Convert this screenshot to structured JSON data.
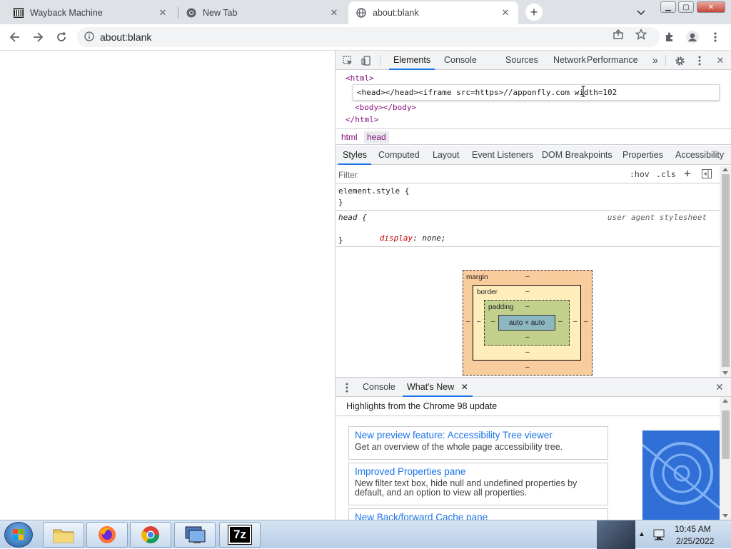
{
  "browser": {
    "tabs": [
      {
        "title": "Wayback Machine",
        "active": false
      },
      {
        "title": "New Tab",
        "active": false
      },
      {
        "title": "about:blank",
        "active": true
      }
    ],
    "url": "about:blank"
  },
  "devtools": {
    "tabs": [
      "Elements",
      "Console",
      "Sources",
      "Network",
      "Performance"
    ],
    "more": "»",
    "dom": {
      "line_html_open": "<html>",
      "edit_text": "<head></head><iframe src=https>//apponfly.com width=102",
      "line_body": "<body></body>",
      "line_html_close": "</html>"
    },
    "breadcrumb": [
      "html",
      "head"
    ],
    "style_tabs": [
      "Styles",
      "Computed",
      "Layout",
      "Event Listeners",
      "DOM Breakpoints",
      "Properties",
      "Accessibility"
    ],
    "filter_placeholder": "Filter",
    "hov": ":hov",
    "cls": ".cls",
    "plus": "+",
    "rules": {
      "element_style_selector": "element.style {",
      "close_brace": "}",
      "head_selector": "head {",
      "ua_label": "user agent stylesheet",
      "prop_name": "display",
      "prop_value": "none;"
    },
    "box_model": {
      "margin": "margin",
      "border": "border",
      "padding": "padding",
      "content": "auto × auto",
      "dash": "–"
    },
    "drawer": {
      "tabs": [
        "Console",
        "What's New"
      ],
      "header": "Highlights from the Chrome 98 update",
      "cards": [
        {
          "title": "New preview feature: Accessibility Tree viewer",
          "desc": "Get an overview of the whole page accessibility tree."
        },
        {
          "title": "Improved Properties pane",
          "desc": "New filter text box, hide null and undefined properties by default, and an option to view all properties."
        },
        {
          "title": "New Back/forward Cache pane",
          "desc": ""
        }
      ]
    }
  },
  "taskbar": {
    "time": "10:45 AM",
    "date": "2/25/2022",
    "apps": [
      "File Explorer",
      "Firefox",
      "Chrome",
      "Remote Desktop",
      "7-Zip"
    ],
    "sevenzip_label": "7z"
  },
  "colors": {
    "accent": "#1a73e8",
    "tag": "#881280",
    "prop": "#c80000"
  }
}
